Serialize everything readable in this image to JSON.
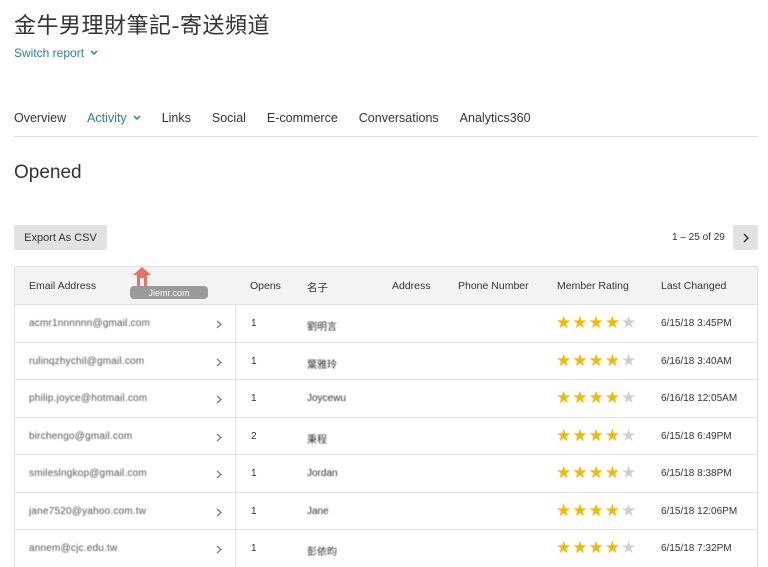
{
  "header": {
    "title": "金牛男理財筆記-寄送頻道",
    "switch_report": "Switch report"
  },
  "tabs": [
    {
      "label": "Overview"
    },
    {
      "label": "Activity"
    },
    {
      "label": "Links"
    },
    {
      "label": "Social"
    },
    {
      "label": "E-commerce"
    },
    {
      "label": "Conversations"
    },
    {
      "label": "Analytics360"
    }
  ],
  "section": {
    "title": "Opened"
  },
  "toolbar": {
    "export_label": "Export As CSV",
    "pagination": "1 – 25 of 29"
  },
  "watermark": {
    "text": "Jiemr.com"
  },
  "table": {
    "columns": [
      "Email Address",
      "Opens",
      "名子",
      "Address",
      "Phone Number",
      "Member Rating",
      "Last Changed"
    ],
    "rows": [
      {
        "email": "acmr1nnnnnn@gmail.com",
        "opens": "1",
        "name": "劉明言",
        "address": "",
        "phone": "",
        "rating": 4,
        "last_changed": "6/15/18 3:45PM"
      },
      {
        "email": "rulinqzhychil@gmail.com",
        "opens": "1",
        "name": "葉雅玲",
        "address": "",
        "phone": "",
        "rating": 4,
        "last_changed": "6/16/18 3:40AM"
      },
      {
        "email": "philip.joyce@hotmail.com",
        "opens": "1",
        "name": "Joycewu",
        "address": "",
        "phone": "",
        "rating": 4,
        "last_changed": "6/16/18 12:05AM"
      },
      {
        "email": "birchengo@gmail.com",
        "opens": "2",
        "name": "秉程",
        "address": "",
        "phone": "",
        "rating": 4,
        "last_changed": "6/15/18 6:49PM"
      },
      {
        "email": "smileslngkop@gmail.com",
        "opens": "1",
        "name": "Jordan",
        "address": "",
        "phone": "",
        "rating": 4,
        "last_changed": "6/15/18 8:38PM"
      },
      {
        "email": "jane7520@yahoo.com.tw",
        "opens": "1",
        "name": "Jane",
        "address": "",
        "phone": "",
        "rating": 4,
        "last_changed": "6/15/18 12:06PM"
      },
      {
        "email": "annem@cjc.edu.tw",
        "opens": "1",
        "name": "彭依昀",
        "address": "",
        "phone": "",
        "rating": 4,
        "last_changed": "6/15/18 7:32PM"
      }
    ],
    "rating_max": 5
  },
  "colors": {
    "accent": "#2a7fa6",
    "star_on": "#f5b800",
    "star_off": "#cfcfcf",
    "button_bg": "#e2e2e2",
    "header_bg": "#f3f3f3"
  }
}
